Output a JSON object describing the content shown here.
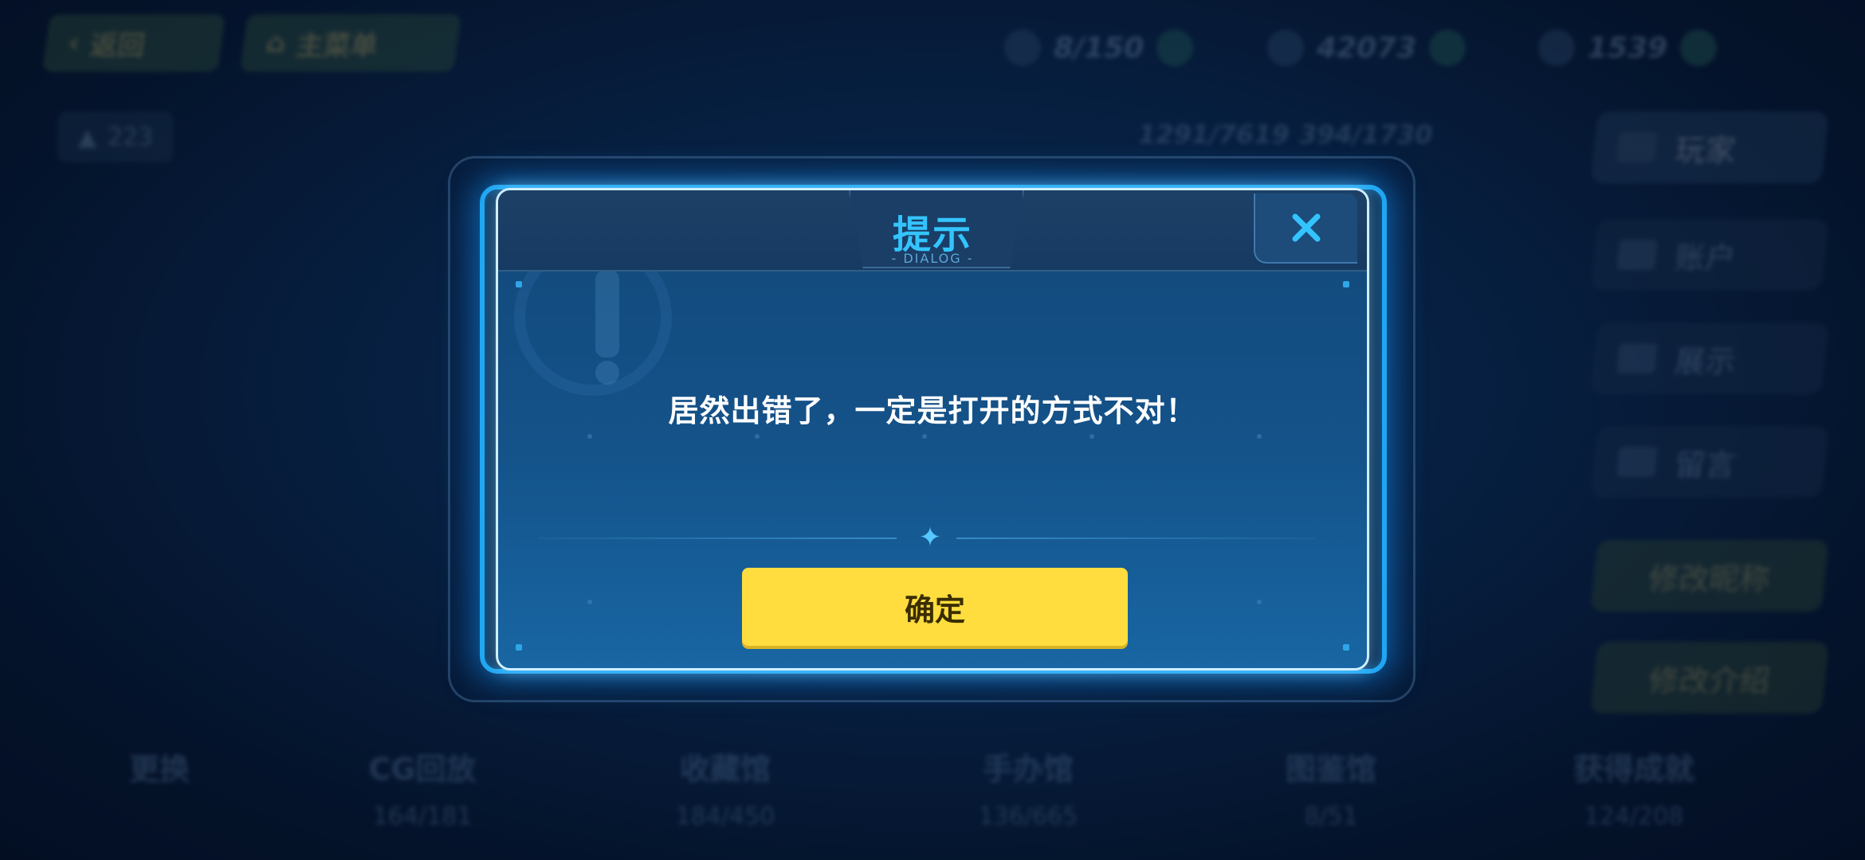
{
  "background": {
    "back_label": "返回",
    "main_menu_label": "主菜单",
    "resources": [
      "8/150",
      "42073",
      "1539"
    ],
    "likes": "223",
    "progress_left": "1291/7619",
    "progress_right": "394/1730",
    "side_tabs": [
      "玩家",
      "账户",
      "展示",
      "留言"
    ],
    "edit_nickname": "修改昵称",
    "edit_intro": "修改介绍",
    "stats": [
      {
        "label": "更换",
        "value": ""
      },
      {
        "label": "CG回放",
        "value": "164/181"
      },
      {
        "label": "收藏馆",
        "value": "184/450"
      },
      {
        "label": "手办馆",
        "value": "136/665"
      },
      {
        "label": "图鉴馆",
        "value": "8/51"
      },
      {
        "label": "获得成就",
        "value": "124/208"
      }
    ]
  },
  "dialog": {
    "title": "提示",
    "subtitle": "- DIALOG -",
    "message": "居然出错了，一定是打开的方式不对！",
    "confirm_label": "确定",
    "close_icon": "close-icon"
  },
  "colors": {
    "accent": "#33c4ff",
    "confirm": "#ffdd3f",
    "frame_glow": "#1ea6f2"
  }
}
